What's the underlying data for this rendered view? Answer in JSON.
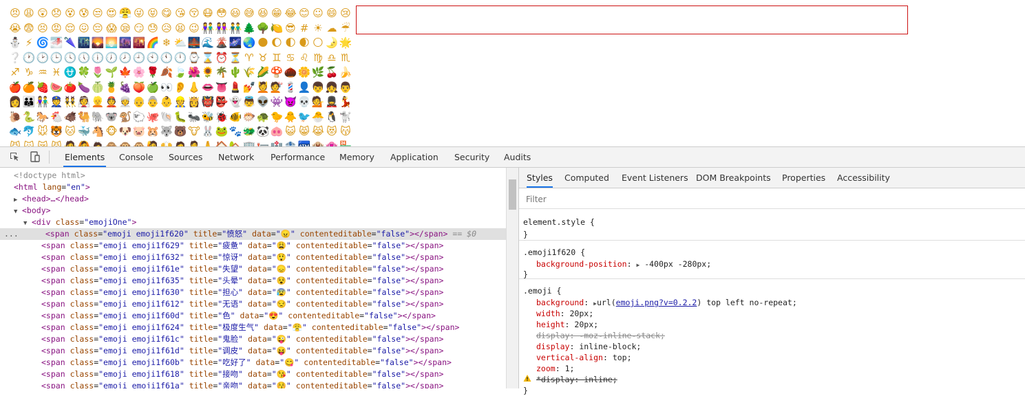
{
  "emoji_rows": [
    "😠😩😲😞😵😰😒😍😤😜😝😋😘😚😷😳😃😅😆😁😂😊☺️😄😢",
    "😭😨😣😡😌😖😔😱😪😏😓😥😫😉👫👭👬🌲🌳🍋😎#️⃣☀️☁️☔",
    "⛄⚡🌀🌁🌂🌃🌄🌅🌆🌇🌈❄️⛅🌉🌊🌋🌌🌏🌑🌔🌓🌒🌕🌛🌟",
    "❔🕐🕑🕒🕓🕔🕕🕖🕗🕘🕙🕚🕛⌚⌛⏰⏳♈♉♊♋♌♍♎♏",
    "♐♑♒♓⛎🍀🌷🌱🍁🌸🌹🍂🍃🌺🌻🌴🌵🌾🌽🍄🌰🌼🌿🍒🍌",
    "🍎🍊🍓🍉🍅🍆🍈🍍🍇🍑🍏👀👂👃👄👅💄💅💆💇💈👤👦👧👨",
    "👩👪👫👮👯👰👱👲👳👴👵👶👷👸👹👺👻👼👽👾👿💀💁💂💃",
    "🐌🐍🐎🐔🐗🐫🐘🐨🐒🐑🐙🐚🐛🐜🐝🐞🐠🐡🐢🐤🐥🐦🐣🐧🐩",
    "🐟🐬🐭🐯🐱🐳🐴🐵🐶🐷🐹🐺🐻🐮🐰🐸🐾🐲🐼🐽😺😸😹😻😽",
    "😼🙀😿😾🙅🙆🙇🙈🙉🙊🙋🙌🙍🙎🙏🏠🏡🏢🏣🏥🏦🏧🏨🏩🏪"
  ],
  "colors": {
    "editor_border": "#cc1111",
    "tab_active_underline": "#1a73e8",
    "tag": "#881280",
    "attr_name": "#994500",
    "attr_value": "#1a1aa6",
    "css_property": "#c80000"
  },
  "toolbar": {
    "inspect_icon": "inspect-element-icon",
    "device_icon": "device-toolbar-icon",
    "tabs": [
      "Elements",
      "Console",
      "Sources",
      "Network",
      "Performance",
      "Memory",
      "Application",
      "Security",
      "Audits"
    ],
    "active_tab": "Elements"
  },
  "dom": {
    "doctype": "<!doctype html>",
    "html_open": "<html",
    "html_lang_attr": "lang",
    "html_lang_val": "\"en\"",
    "html_close": ">",
    "head": "<head>…</head>",
    "body": "<body>",
    "div_open": "<div",
    "div_class_attr": "class",
    "div_class_val": "\"emojiOne\"",
    "div_close": ">",
    "selected_marker": "== $0",
    "ellipsis": "...",
    "span_lines": [
      {
        "cls": "\"emoji emoji1f620\"",
        "title": "\"愤怒\"",
        "data": "\"😠\"",
        "ce": "\"false\""
      },
      {
        "cls": "\"emoji emoji1f629\"",
        "title": "\"疲惫\"",
        "data": "\"😩\"",
        "ce": "\"false\""
      },
      {
        "cls": "\"emoji emoji1f632\"",
        "title": "\"惊讶\"",
        "data": "\"😲\"",
        "ce": "\"false\""
      },
      {
        "cls": "\"emoji emoji1f61e\"",
        "title": "\"失望\"",
        "data": "\"😞\"",
        "ce": "\"false\""
      },
      {
        "cls": "\"emoji emoji1f635\"",
        "title": "\"头晕\"",
        "data": "\"😵\"",
        "ce": "\"false\""
      },
      {
        "cls": "\"emoji emoji1f630\"",
        "title": "\"担心\"",
        "data": "\"😰\"",
        "ce": "\"false\""
      },
      {
        "cls": "\"emoji emoji1f612\"",
        "title": "\"无语\"",
        "data": "\"😒\"",
        "ce": "\"false\""
      },
      {
        "cls": "\"emoji emoji1f60d\"",
        "title": "\"色\"",
        "data": "\"😍\"",
        "ce": "\"false\""
      },
      {
        "cls": "\"emoji emoji1f624\"",
        "title": "\"极度生气\"",
        "data": "\"😤\"",
        "ce": "\"false\""
      },
      {
        "cls": "\"emoji emoji1f61c\"",
        "title": "\"鬼脸\"",
        "data": "\"😜\"",
        "ce": "\"false\""
      },
      {
        "cls": "\"emoji emoji1f61d\"",
        "title": "\"调皮\"",
        "data": "\"😝\"",
        "ce": "\"false\""
      },
      {
        "cls": "\"emoji emoji1f60b\"",
        "title": "\"吃好了\"",
        "data": "\"😋\"",
        "ce": "\"false\""
      },
      {
        "cls": "\"emoji emoji1f618\"",
        "title": "\"接吻\"",
        "data": "\"😘\"",
        "ce": "\"false\""
      },
      {
        "cls": "\"emoji emoji1f61a\"",
        "title": "\"亲吻\"",
        "data": "\"😚\"",
        "ce": "\"false\""
      }
    ],
    "span_tag": "<span",
    "span_class_attr": "class",
    "span_title_attr": "title",
    "span_data_attr": "data",
    "span_ce_attr": "contenteditable",
    "span_end": "></span>",
    "eq": "="
  },
  "styles_pane": {
    "tabs": [
      "Styles",
      "Computed",
      "Event Listeners",
      "DOM Breakpoints",
      "Properties",
      "Accessibility"
    ],
    "active_tab": "Styles",
    "filter_placeholder": "Filter",
    "element_style": "element.style {",
    "close_brace": "}",
    "rule1_selector": ".emoji1f620 {",
    "rule1_prop": "background-position",
    "rule1_value": "-400px -280px;",
    "rule2_selector": ".emoji {",
    "rule2_bg_prop": "background",
    "rule2_bg_url_pre": "url(",
    "rule2_bg_url_link": "emoji.png?v=0.2.2",
    "rule2_bg_url_post": ") top left no-repeat;",
    "rule2_width_prop": "width",
    "rule2_width_val": "20px;",
    "rule2_height_prop": "height",
    "rule2_height_val": "20px;",
    "rule2_display_moz": "display: -moz-inline-stack;",
    "rule2_display_prop": "display",
    "rule2_display_val": "inline-block;",
    "rule2_valign_prop": "vertical-align",
    "rule2_valign_val": "top;",
    "rule2_zoom_prop": "zoom",
    "rule2_zoom_val": "1;",
    "rule2_star_display": "*display: inline;",
    "colon": ":",
    "expand_arrow": "▶",
    "warning_icon": "warning-icon"
  }
}
